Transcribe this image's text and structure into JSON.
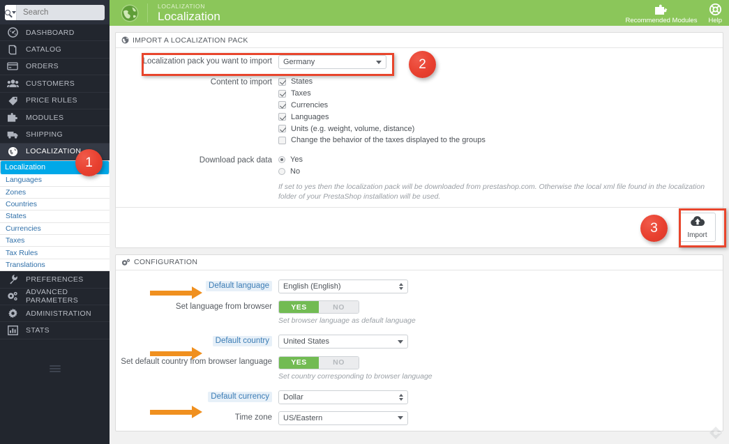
{
  "search": {
    "placeholder": "Search",
    "value": ""
  },
  "sidebar": {
    "main_items": [
      {
        "label": "DASHBOARD",
        "icon": "gauge-icon",
        "active": false
      },
      {
        "label": "CATALOG",
        "icon": "book-icon",
        "active": false
      },
      {
        "label": "ORDERS",
        "icon": "card-icon",
        "active": false
      },
      {
        "label": "CUSTOMERS",
        "icon": "people-icon",
        "active": false
      },
      {
        "label": "PRICE RULES",
        "icon": "tag-icon",
        "active": false
      },
      {
        "label": "MODULES",
        "icon": "puzzle-icon",
        "active": false
      },
      {
        "label": "SHIPPING",
        "icon": "truck-icon",
        "active": false
      },
      {
        "label": "LOCALIZATION",
        "icon": "globe-icon",
        "active": true
      }
    ],
    "sub_items": [
      {
        "label": "Localization",
        "selected": true
      },
      {
        "label": "Languages",
        "selected": false
      },
      {
        "label": "Zones",
        "selected": false
      },
      {
        "label": "Countries",
        "selected": false
      },
      {
        "label": "States",
        "selected": false
      },
      {
        "label": "Currencies",
        "selected": false
      },
      {
        "label": "Taxes",
        "selected": false
      },
      {
        "label": "Tax Rules",
        "selected": false
      },
      {
        "label": "Translations",
        "selected": false
      }
    ],
    "bottom_items": [
      {
        "label": "PREFERENCES",
        "icon": "wrench-icon"
      },
      {
        "label": "ADVANCED PARAMETERS",
        "icon": "gears-icon"
      },
      {
        "label": "ADMINISTRATION",
        "icon": "gear-icon"
      },
      {
        "label": "STATS",
        "icon": "bars-icon"
      }
    ]
  },
  "header": {
    "kicker": "LOCALIZATION",
    "title": "Localization",
    "recommended_modules": "Recommended Modules",
    "help": "Help"
  },
  "import_panel": {
    "heading": "IMPORT A LOCALIZATION PACK",
    "pack_label": "Localization pack you want to import",
    "pack_value": "Germany",
    "content_label": "Content to import",
    "content_options": [
      {
        "label": "States",
        "checked": true
      },
      {
        "label": "Taxes",
        "checked": true
      },
      {
        "label": "Currencies",
        "checked": true
      },
      {
        "label": "Languages",
        "checked": true
      },
      {
        "label": "Units (e.g. weight, volume, distance)",
        "checked": true
      },
      {
        "label": "Change the behavior of the taxes displayed to the groups",
        "checked": false
      }
    ],
    "download_label": "Download pack data",
    "download_options": [
      {
        "label": "Yes",
        "selected": true
      },
      {
        "label": "No",
        "selected": false
      }
    ],
    "hint": "If set to yes then the localization pack will be downloaded from prestashop.com. Otherwise the local xml file found in the localization folder of your PrestaShop installation will be used.",
    "import_button": "Import"
  },
  "configuration": {
    "heading": "CONFIGURATION",
    "default_language_label": "Default language",
    "default_language_value": "English (English)",
    "set_language_browser_label": "Set language from browser",
    "set_language_browser_yes": "YES",
    "set_language_browser_no": "NO",
    "set_language_browser_hint": "Set browser language as default language",
    "default_country_label": "Default country",
    "default_country_value": "United States",
    "set_country_browser_label": "Set default country from browser language",
    "set_country_browser_yes": "YES",
    "set_country_browser_no": "NO",
    "set_country_browser_hint": "Set country corresponding to browser language",
    "default_currency_label": "Default currency",
    "default_currency_value": "Dollar",
    "timezone_label": "Time zone",
    "timezone_value": "US/Eastern"
  },
  "annotations": {
    "badges": [
      {
        "number": "1"
      },
      {
        "number": "2"
      },
      {
        "number": "3"
      }
    ]
  },
  "colors": {
    "header_green": "#8bc65a",
    "sidebar_dark": "#22262e",
    "accent_blue": "#00a8e8",
    "badge_red": "#e8402f",
    "arrow_orange": "#f0901f",
    "toggle_green": "#72bb53"
  }
}
